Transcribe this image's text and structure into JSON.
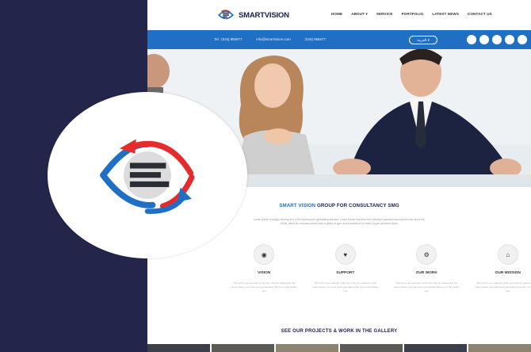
{
  "brand": {
    "name": "SMARTVISION"
  },
  "nav": {
    "items": [
      "HOME",
      "ABOUT ▾",
      "SERVICE",
      "PORTFOLIO",
      "LATEST NEWS",
      "CONTACT US"
    ]
  },
  "infobar": {
    "phone1": "Tel : (016) 955677",
    "email": "info@smartvision.com",
    "phone2": "(016) 955677",
    "language_label": "العربية ▾"
  },
  "social_icons": [
    "facebook-icon",
    "twitter-icon",
    "linkedin-icon",
    "google-plus-icon",
    "youtube-icon"
  ],
  "content": {
    "title_highlight": "SMART VISION",
    "title_rest": "GROUP FOR CONSULTANCY SMG",
    "lead": "Lorem Ipsum is simply dummy text of the printing and typesetting industry. Lorem Ipsum has been the industry's standard dummy text ever since the 1500s, when an unknown printer took a galley of type and scrambled it to make a type specimen book."
  },
  "features": [
    {
      "icon": "eye-icon",
      "label": "VISION",
      "text": "This text is an example of the text may be replaced in the same space, so it has been generating this text of the Arabic text"
    },
    {
      "icon": "heart-icon",
      "label": "SUPPORT",
      "text": "This text is an example of the text may be replaced in the same space, so it has been generating this text of the Arabic text"
    },
    {
      "icon": "gears-icon",
      "label": "OUR WORK",
      "text": "This text is an example of the text may be replaced in the same space, so it has been generating this text of the Arabic text"
    },
    {
      "icon": "home-icon",
      "label": "OUR MISSION",
      "text": "This text is an example of the text may be replaced in the same space, so it has been generating this text of the Arabic text"
    }
  ],
  "gallery": {
    "title": "SEE OUR PROJECTS & WORK IN THE GALLERY"
  },
  "colors": {
    "navy": "#23264a",
    "blue": "#1f6fc5",
    "red": "#e52b2b"
  }
}
